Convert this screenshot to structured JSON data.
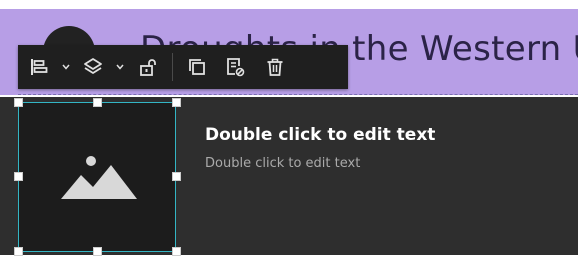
{
  "header": {
    "title": "Droughts in the Western USA",
    "background": "#b79ee6"
  },
  "toolbar": {
    "items": [
      {
        "icon": "align-left-icon",
        "has_dropdown": true
      },
      {
        "icon": "layers-icon",
        "has_dropdown": true
      },
      {
        "icon": "unlock-icon"
      },
      {
        "icon": "duplicate-icon"
      },
      {
        "icon": "edit-note-icon"
      },
      {
        "icon": "trash-icon"
      }
    ]
  },
  "card": {
    "title": "Double click to edit text",
    "subtitle": "Double click to edit text",
    "image_icon": "image-placeholder-icon",
    "selection_color": "#33b5c4"
  }
}
